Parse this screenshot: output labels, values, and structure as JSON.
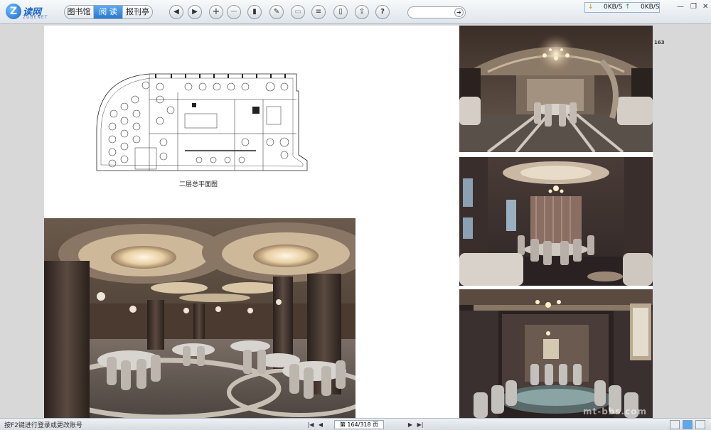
{
  "app": {
    "logo_letter": "Z",
    "logo_name": "读网",
    "logo_sub": "ZUBENET"
  },
  "nav": {
    "tabs": [
      {
        "label": "图书馆",
        "active": false
      },
      {
        "label": "阅 读",
        "active": true
      },
      {
        "label": "报刊亭",
        "active": false
      }
    ]
  },
  "toolbar": {
    "buttons": [
      {
        "name": "prev-page-icon",
        "glyph": "◀"
      },
      {
        "name": "next-page-icon",
        "glyph": "▶"
      },
      {
        "name": "zoom-in-icon",
        "glyph": "+"
      },
      {
        "name": "zoom-out-icon",
        "glyph": "−"
      },
      {
        "name": "bookmark-icon",
        "glyph": "▮"
      },
      {
        "name": "edit-icon",
        "glyph": "✎"
      },
      {
        "name": "print-icon",
        "glyph": "▭"
      },
      {
        "name": "list-icon",
        "glyph": "≡"
      },
      {
        "name": "book-icon",
        "glyph": "▯"
      },
      {
        "name": "share-icon",
        "glyph": "⇪"
      },
      {
        "name": "help-icon",
        "glyph": "?"
      }
    ],
    "search_go_glyph": "➔"
  },
  "speed": {
    "download": "0KB/S",
    "upload": "0KB/S",
    "down_arrow": "↓",
    "up_arrow": "↑"
  },
  "window": {
    "minimize": "—",
    "restore": "❐",
    "close": "✕"
  },
  "page": {
    "plan_caption": "二层总平面图",
    "page_number": "163"
  },
  "statusbar": {
    "hint": "按F2键进行登录或更改账号",
    "first_glyph": "|◀",
    "prev_glyph": "◀",
    "page_indicator": "第 164/318 页",
    "next_glyph": "▶",
    "last_glyph": "▶|"
  },
  "watermark": "mt-bbs.com"
}
